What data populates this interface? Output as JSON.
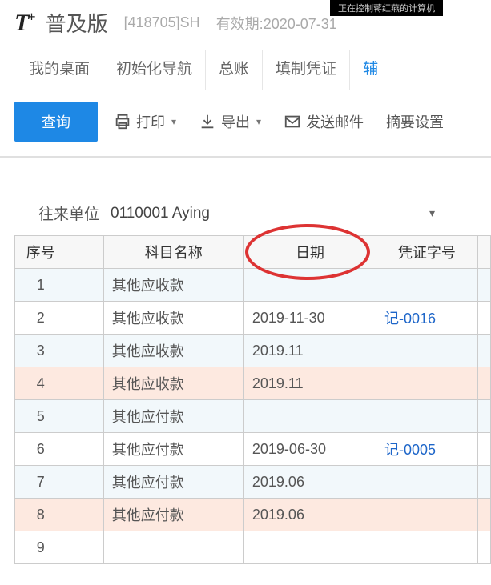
{
  "notification": "正在控制蒋红燕的计算机",
  "header": {
    "logo_suffix": "普及版",
    "company_code": "[418705]SH",
    "valid_until_label": "有效期:",
    "valid_until_value": "2020-07-31"
  },
  "tabs": {
    "desktop": "我的桌面",
    "init_nav": "初始化导航",
    "general_ledger": "总账",
    "voucher_entry": "填制凭证",
    "aux": "辅"
  },
  "toolbar": {
    "query": "查询",
    "print": "打印",
    "export": "导出",
    "send_mail": "发送邮件",
    "summary": "摘要设置"
  },
  "filter": {
    "label": "往来单位",
    "value": "0110001 Aying"
  },
  "table": {
    "headers": {
      "seq": "序号",
      "name": "科目名称",
      "date": "日期",
      "vno": "凭证字号"
    },
    "rows": [
      {
        "seq": "1",
        "name": "其他应收款",
        "date": "",
        "vno": ""
      },
      {
        "seq": "2",
        "name": "其他应收款",
        "date": "2019-11-30",
        "vno": "记-0016"
      },
      {
        "seq": "3",
        "name": "其他应收款",
        "date": "2019.11",
        "vno": ""
      },
      {
        "seq": "4",
        "name": "其他应收款",
        "date": "2019.11",
        "vno": ""
      },
      {
        "seq": "5",
        "name": "其他应付款",
        "date": "",
        "vno": ""
      },
      {
        "seq": "6",
        "name": "其他应付款",
        "date": "2019-06-30",
        "vno": "记-0005"
      },
      {
        "seq": "7",
        "name": "其他应付款",
        "date": "2019.06",
        "vno": ""
      },
      {
        "seq": "8",
        "name": "其他应付款",
        "date": "2019.06",
        "vno": ""
      },
      {
        "seq": "9",
        "name": "",
        "date": "",
        "vno": ""
      }
    ]
  }
}
